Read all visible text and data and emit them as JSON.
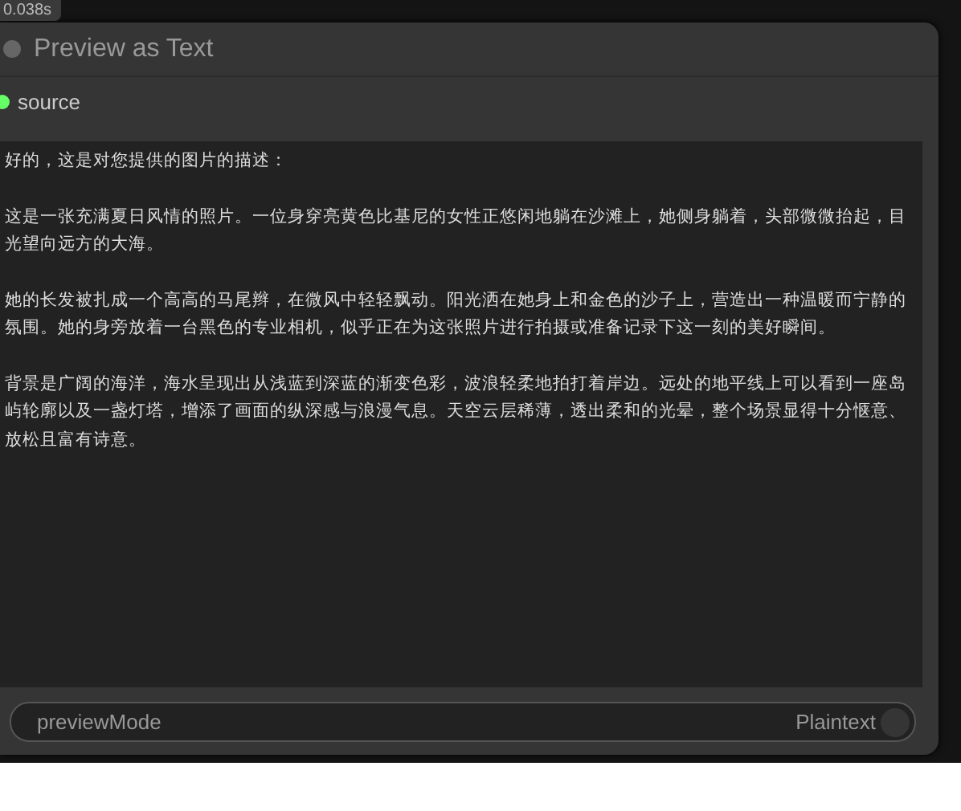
{
  "execution_time": "0.038s",
  "node": {
    "title": "Preview as Text",
    "collapsed": false,
    "inputs": [
      {
        "name": "source",
        "connected": true
      }
    ],
    "text": [
      "好的，这是对您提供的图片的描述：",
      "这是一张充满夏日风情的照片。一位身穿亮黄色比基尼的女性正悠闲地躺在沙滩上，她侧身躺着，头部微微抬起，目光望向远方的大海。",
      "她的长发被扎成一个高高的马尾辫，在微风中轻轻飘动。阳光洒在她身上和金色的沙子上，营造出一种温暖而宁静的氛围。她的身旁放着一台黑色的专业相机，似乎正在为这张照片进行拍摄或准备记录下这一刻的美好瞬间。",
      "背景是广阔的海洋，海水呈现出从浅蓝到深蓝的渐变色彩，波浪轻柔地拍打着岸边。远处的地平线上可以看到一座岛屿轮廓以及一盏灯塔，增添了画面的纵深感与浪漫气息。天空云层稀薄，透出柔和的光晕，整个场景显得十分惬意、放松且富有诗意。"
    ],
    "widgets": [
      {
        "label": "previewMode",
        "value": "Plaintext",
        "on": false
      }
    ]
  }
}
